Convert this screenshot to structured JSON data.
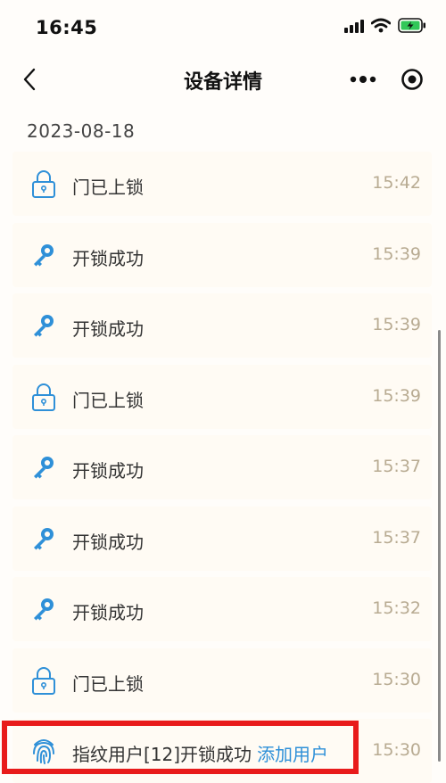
{
  "status": {
    "time": "16:45"
  },
  "nav": {
    "title": "设备详情"
  },
  "date": "2023-08-18",
  "icons": {
    "lock": "lock-icon",
    "key": "key-icon",
    "fingerprint": "fingerprint-icon"
  },
  "colors": {
    "accent": "#2f90d8",
    "time": "#b8ab92",
    "highlight": "#e81b1b"
  },
  "logs": [
    {
      "type": "lock",
      "text": "门已上锁",
      "time": "15:42"
    },
    {
      "type": "key",
      "text": "开锁成功",
      "time": "15:39"
    },
    {
      "type": "key",
      "text": "开锁成功",
      "time": "15:39"
    },
    {
      "type": "lock",
      "text": "门已上锁",
      "time": "15:39"
    },
    {
      "type": "key",
      "text": "开锁成功",
      "time": "15:37"
    },
    {
      "type": "key",
      "text": "开锁成功",
      "time": "15:37"
    },
    {
      "type": "key",
      "text": "开锁成功",
      "time": "15:32"
    },
    {
      "type": "lock",
      "text": "门已上锁",
      "time": "15:30"
    },
    {
      "type": "fingerprint",
      "text": "指纹用户[12]开锁成功",
      "link": "添加用户",
      "time": "15:30"
    }
  ]
}
